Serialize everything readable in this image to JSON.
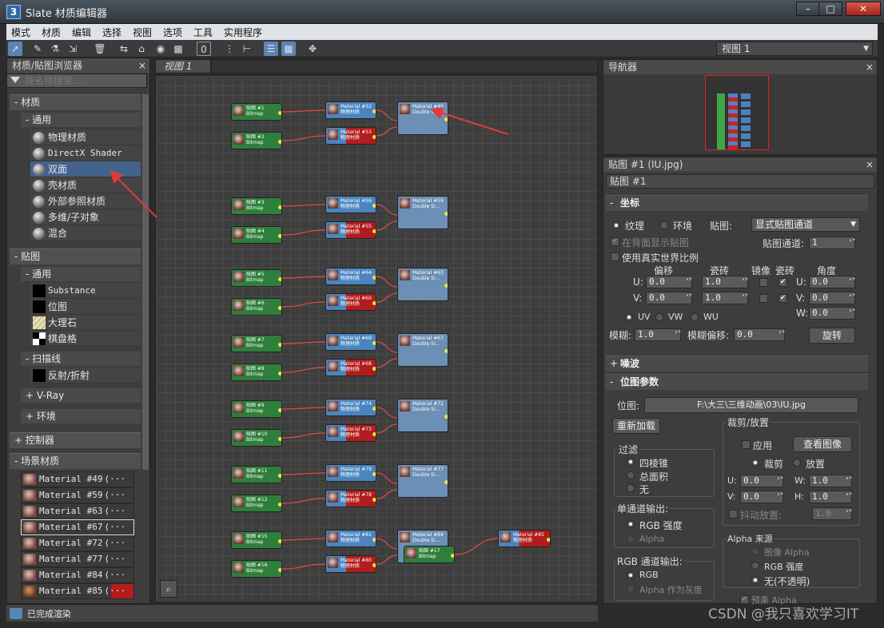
{
  "window": {
    "title": "Slate 材质编辑器",
    "app_icon": "3"
  },
  "menu": [
    "模式",
    "材质",
    "编辑",
    "选择",
    "视图",
    "选项",
    "工具",
    "实用程序"
  ],
  "toolbar": {
    "view_select": "视图 1"
  },
  "browser": {
    "title": "材质/贴图浏览器",
    "search_placeholder": "按名称搜索...",
    "materials_group": "- 材质",
    "materials_general": "- 通用",
    "material_items": [
      "物理材质",
      "DirectX Shader",
      "双面",
      "壳材质",
      "外部参照材质",
      "多维/子对象",
      "混合"
    ],
    "maps_group": "- 贴图",
    "maps_general": "- 通用",
    "map_items": [
      "Substance",
      "位图",
      "大理石",
      "棋盘格"
    ],
    "scanline": "- 扫描线",
    "scanline_items": [
      "反射/折射"
    ],
    "vray": "+ V-Ray",
    "env": "+ 环境",
    "controllers": "+ 控制器",
    "scene_materials": "- 场景材质",
    "scene_items": [
      "Material #49",
      "Material #59",
      "Material #63",
      "Material #67",
      "Material #72",
      "Material #77",
      "Material #84",
      "Material #85"
    ],
    "scene_more": "(···"
  },
  "status": "已完成渲染",
  "view": {
    "tab": "视图 1"
  },
  "nodes": {
    "bitmap_label": "贴图",
    "bitmap_sub": "Bitmap",
    "bitmaps": [
      "贴图 #1",
      "贴图 #2",
      "贴图 #3",
      "贴图 #4",
      "贴图 #5",
      "贴图 #6",
      "贴图 #7",
      "贴图 #8",
      "贴图 #9",
      "贴图 #10",
      "贴图 #11",
      "贴图 #12",
      "贴图 #15",
      "贴图 #16"
    ],
    "physical": [
      "Material #52",
      "Material #53",
      "Material #56",
      "Material #55",
      "Material #64",
      "Material #60",
      "Material #69",
      "Material #68",
      "Material #74",
      "Material #73",
      "Material #79",
      "Material #78",
      "Material #81",
      "Material #80"
    ],
    "physical_sub": "物理材质",
    "double": [
      "Material #49",
      "Material #59",
      "Material #63",
      "Material #67",
      "Material #72",
      "Material #77",
      "Material #84"
    ],
    "double_sub": "Double Si...",
    "extra": [
      "贴图 #17",
      "Material #85"
    ]
  },
  "navigator": {
    "title": "导航器"
  },
  "params": {
    "title": "贴图 #1 (IU.jpg)",
    "name": "贴图 #1",
    "coords": "坐标",
    "texture": "纹理",
    "environ": "环境",
    "mapping_label": "贴图:",
    "mapping_value": "显式贴图通道",
    "show_back": "在背面显示贴图",
    "map_channel_label": "贴图通道:",
    "map_channel": "1",
    "real_world": "使用真实世界比例",
    "offset": "偏移",
    "tiling": "瓷砖",
    "mirror": "镜像",
    "tile": "瓷砖",
    "angle": "角度",
    "u": "U:",
    "v": "V:",
    "w": "W:",
    "u_offset": "0.0",
    "v_offset": "0.0",
    "u_tiling": "1.0",
    "v_tiling": "1.0",
    "u_angle": "0.0",
    "v_angle": "0.0",
    "w_angle": "0.0",
    "uv": "UV",
    "vw": "VW",
    "wu": "WU",
    "blur_label": "模糊:",
    "blur": "1.0",
    "blur_offset_label": "模糊偏移:",
    "blur_offset": "0.0",
    "rotate": "旋转",
    "noise": "噪波",
    "bitmap_params": "位图参数",
    "bitmap_label": "位图:",
    "bitmap_path": "F:\\大三\\三维动画\\03\\IU.jpg",
    "reload": "重新加载",
    "crop_title": "裁剪/放置",
    "apply": "应用",
    "view_image": "查看图像",
    "crop": "裁剪",
    "place": "放置",
    "crop_u": "0.0",
    "crop_v": "0.0",
    "crop_w": "1.0",
    "crop_h": "1.0",
    "jitter": "抖动放置:",
    "jitter_val": "1.0",
    "w_lbl": "W:",
    "h_lbl": "H:",
    "filter_title": "过滤",
    "pyramidal": "四棱锥",
    "summed": "总面积",
    "none": "无",
    "mono_title": "单通道输出:",
    "rgb_intensity": "RGB 强度",
    "alpha": "Alpha",
    "rgb_title": "RGB 通道输出:",
    "rgb": "RGB",
    "alpha_gray": "Alpha 作为灰度",
    "alpha_src_title": "Alpha 来源",
    "image_alpha": "图像 Alpha",
    "rgb_int2": "RGB 强度",
    "opaque": "无(不透明)",
    "premult": "预乘 Alpha"
  },
  "watermark": "CSDN @我只喜欢学习IT",
  "colors": {
    "accent": "#5a86b6",
    "arrow": "#e23a3a"
  }
}
